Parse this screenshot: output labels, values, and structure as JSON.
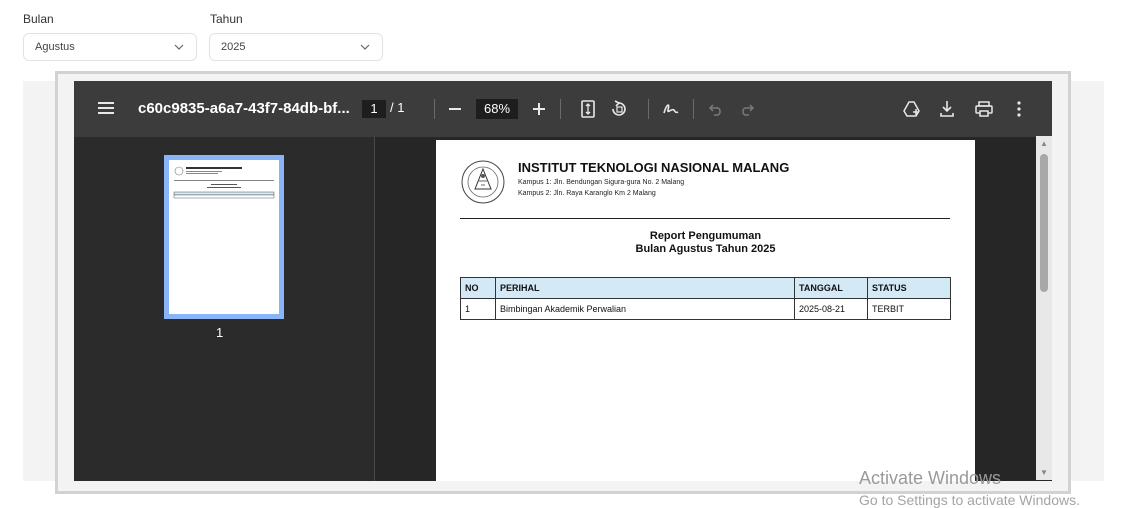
{
  "filters": {
    "month": {
      "label": "Bulan",
      "value": "Agustus"
    },
    "year": {
      "label": "Tahun",
      "value": "2025"
    }
  },
  "viewer": {
    "title": "c60c9835-a6a7-43f7-84db-bf...",
    "page_current": "1",
    "page_total": "/ 1",
    "zoom": "68%",
    "thumbnail_number": "1",
    "icons": [
      "menu-icon",
      "zoom-out-icon",
      "zoom-in-icon",
      "fit-page-icon",
      "rotate-icon",
      "annotate-icon",
      "undo-icon",
      "redo-icon",
      "add-to-drive-icon",
      "download-icon",
      "print-icon",
      "more-options-icon"
    ]
  },
  "document": {
    "org_name": "INSTITUT TEKNOLOGI NASIONAL MALANG",
    "address1": "Kampus 1: Jln. Bendungan Sigura-gura No. 2 Malang",
    "address2": "Kampus 2: Jln. Raya Karanglo Km 2 Malang",
    "report_title": "Report Pengumuman",
    "report_subtitle": "Bulan Agustus Tahun 2025",
    "table": {
      "headers": [
        "NO",
        "PERIHAL",
        "TANGGAL",
        "STATUS"
      ],
      "rows": [
        [
          "1",
          "Bimbingan Akademik Perwalian",
          "2025-08-21",
          "TERBIT"
        ]
      ]
    }
  },
  "watermark": {
    "line1": "Activate Windows",
    "line2": "Go to Settings to activate Windows."
  },
  "colors": {
    "toolbar": "#3c3c3c",
    "viewer_bg": "#333638",
    "table_header": "#d3e9f5",
    "thumb_highlight": "#8ab4f8"
  }
}
